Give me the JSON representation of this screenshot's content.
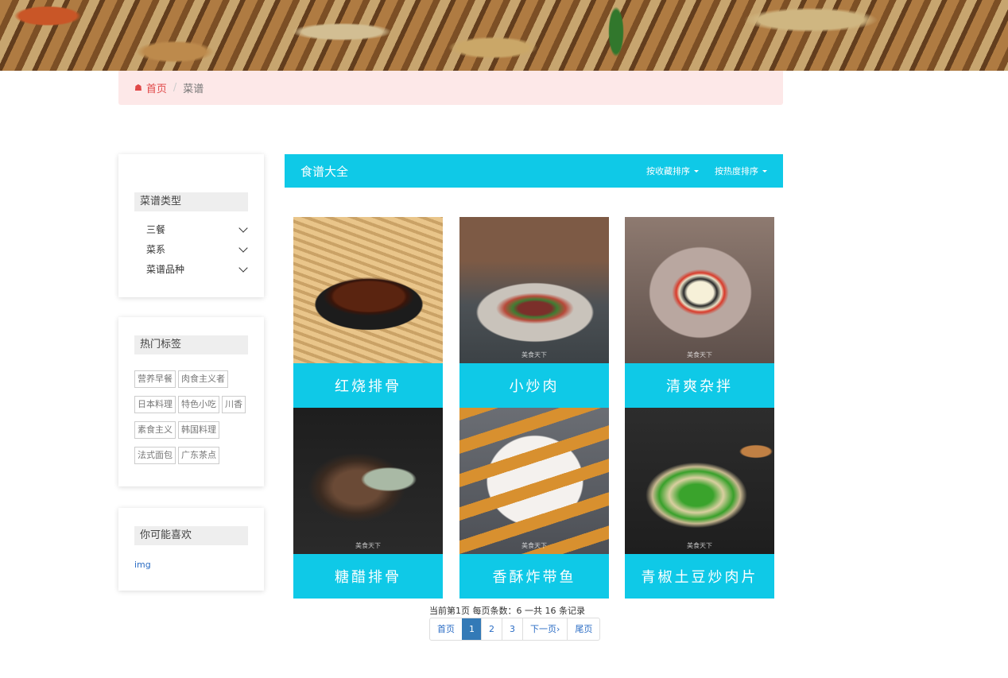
{
  "breadcrumb": {
    "home": "首页",
    "current": "菜谱"
  },
  "sidebar": {
    "categories": {
      "title": "菜谱类型",
      "items": [
        {
          "label": "三餐"
        },
        {
          "label": "菜系"
        },
        {
          "label": "菜谱品种"
        }
      ]
    },
    "hot_tags": {
      "title": "热门标签",
      "rows": [
        [
          "营养早餐",
          "肉食主义者"
        ],
        [
          "日本料理",
          "特色小吃",
          "川香"
        ],
        [
          "素食主义",
          "韩国料理"
        ],
        [
          "法式面包",
          "广东茶点"
        ]
      ]
    },
    "recommend": {
      "title": "你可能喜欢",
      "link": "img"
    }
  },
  "main": {
    "title": "食谱大全",
    "sort_favorites": "按收藏排序",
    "sort_popularity": "按热度排序",
    "recipes": [
      {
        "name": "红烧排骨"
      },
      {
        "name": "小炒肉",
        "watermark": "美食天下"
      },
      {
        "name": "清爽杂拌",
        "watermark": "美食天下"
      },
      {
        "name": "糖醋排骨",
        "watermark": "美食天下"
      },
      {
        "name": "香酥炸带鱼",
        "watermark": "美食天下"
      },
      {
        "name": "青椒土豆炒肉片",
        "watermark": "美食天下"
      }
    ]
  },
  "pagination": {
    "info": "当前第1页 每页条数：6 一共 16 条记录",
    "first": "首页",
    "pages": [
      "1",
      "2",
      "3"
    ],
    "next": "下一页›",
    "last": "尾页",
    "current": "1"
  },
  "colors": {
    "accent": "#0fc9e7",
    "breadcrumb_bg": "#fde8e8",
    "link": "#2a6cc4",
    "home_link": "#e04848"
  }
}
